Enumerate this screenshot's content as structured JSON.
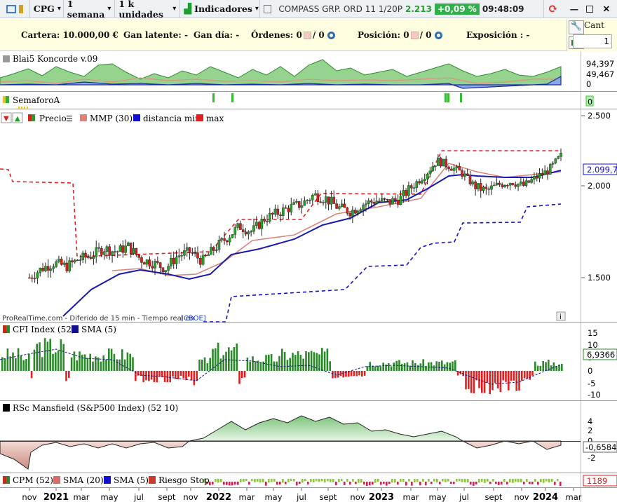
{
  "toolbar": {
    "ticker": "CPG",
    "period": "1 semana",
    "units": "1 k unidades",
    "indicators": "Indicadores",
    "instrument": "COMPASS GRP. ORD 11 1/20P",
    "price": "2.213",
    "change": "+0,09 %",
    "time": "09:48:09"
  },
  "colors": {
    "green": "#1e9e2e",
    "red": "#e02020",
    "blue": "#1010d0",
    "salmon": "#d9847a",
    "posbadge": "#2fb04a"
  },
  "infobar": {
    "cartera": "Cartera: 10.000,00 €",
    "latente": "Gan latente: -",
    "gandia": "Gan día: -",
    "ordenes": "Órdenes: 0",
    "ordenes2": "/ 0",
    "posicion": "Posición: 0",
    "posicion2": "/ 0",
    "exposicion": "Exposición : -"
  },
  "qty": {
    "label": "Cant",
    "value": "1"
  },
  "panels": {
    "koncorde": {
      "title": "Blai5 Koncorde v.09",
      "v1": "94,397",
      "v2": "49,467",
      "v3": "0"
    },
    "semaforo": {
      "title": "SemaforoA",
      "v": "0"
    },
    "price": {
      "legend": [
        "Precio",
        "MMP (30)",
        "distancia min",
        "max"
      ],
      "scale": [
        "2.500",
        "2.000",
        "1.500"
      ],
      "badge": "2.099,7",
      "credit": "ProRealTime.com - Diferido de 15 min - Tiempo real en",
      "credit_link": "[CBOE]"
    },
    "cfi": {
      "title": "CFI Index (52)",
      "sma": "SMA (5)",
      "scale": [
        "15",
        "10",
        "5",
        "0",
        "-5",
        "-10"
      ],
      "badge": "6,9366"
    },
    "rsc": {
      "title": "RSc Mansfield (S&P500 Index) (52 10)",
      "scale": [
        "4",
        "2",
        "0",
        "-2"
      ],
      "badge": "-0,6584"
    },
    "cpm": {
      "title": "CPM (52)",
      "sma20": "SMA (20)",
      "sma5": "SMA (5)",
      "riesgo": "Riesgo Stop",
      "badge": "1189"
    }
  },
  "xaxis": [
    {
      "t": "nov",
      "b": false
    },
    {
      "t": "2021",
      "b": true
    },
    {
      "t": "mar",
      "b": false
    },
    {
      "t": "may",
      "b": false
    },
    {
      "t": "jul",
      "b": false
    },
    {
      "t": "sept",
      "b": false
    },
    {
      "t": "nov",
      "b": false
    },
    {
      "t": "2022",
      "b": true
    },
    {
      "t": "mar",
      "b": false
    },
    {
      "t": "may",
      "b": false
    },
    {
      "t": "jul",
      "b": false
    },
    {
      "t": "sept",
      "b": false
    },
    {
      "t": "nov",
      "b": false
    },
    {
      "t": "2023",
      "b": true
    },
    {
      "t": "mar",
      "b": false
    },
    {
      "t": "may",
      "b": false
    },
    {
      "t": "jul",
      "b": false
    },
    {
      "t": "sept",
      "b": false
    },
    {
      "t": "nov",
      "b": false
    },
    {
      "t": "2024",
      "b": true
    },
    {
      "t": "mar",
      "b": false
    }
  ],
  "chart_data": {
    "type": "candlestick",
    "series": [
      {
        "name": "Precio",
        "values": [
          1.5,
          1.55,
          1.58,
          1.56,
          1.6,
          1.62,
          1.66,
          1.64,
          1.67,
          1.6,
          1.58,
          1.55,
          1.62,
          1.64,
          1.59,
          1.66,
          1.72,
          1.78,
          1.75,
          1.82,
          1.85,
          1.88,
          1.9,
          1.95,
          1.93,
          1.88,
          1.86,
          1.9,
          1.92,
          1.91,
          1.93,
          2.0,
          2.08,
          2.18,
          2.14,
          2.09,
          2.0,
          1.97,
          2.01,
          2.03,
          2.0,
          2.06,
          2.11,
          2.213
        ]
      }
    ]
  }
}
